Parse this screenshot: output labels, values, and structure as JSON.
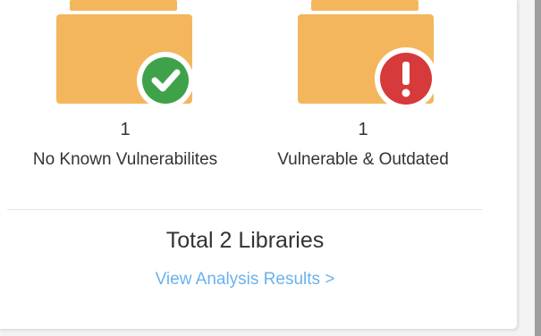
{
  "libraries": [
    {
      "count": "1",
      "label": "No Known Vulnerabilites",
      "status": "safe",
      "status_icon": "check-icon",
      "status_color": "#3fa24a"
    },
    {
      "count": "1",
      "label": "Vulnerable & Outdated",
      "status": "vulnerable",
      "status_icon": "exclamation-icon",
      "status_color": "#d63a3a"
    }
  ],
  "folder_color": "#f4b65d",
  "summary": {
    "total_label": "Total 2 Libraries",
    "link_label": "View Analysis Results >"
  },
  "link_color": "#6ab2ee"
}
